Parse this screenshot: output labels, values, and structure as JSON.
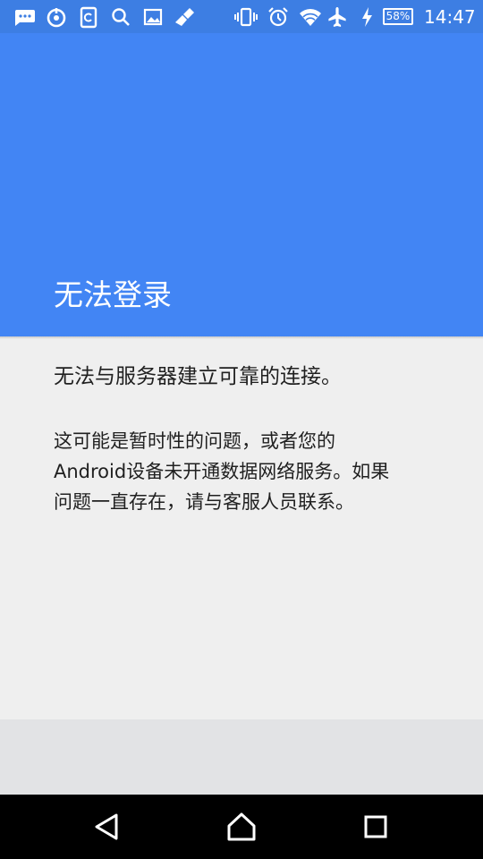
{
  "status_bar": {
    "left_icons": [
      "messages-icon",
      "sync-icon",
      "clipboard-icon",
      "search-icon",
      "image-icon",
      "clean-icon"
    ],
    "right_icons": [
      "vibrate-icon",
      "alarm-icon",
      "wifi-icon",
      "airplane-icon",
      "charging-icon"
    ],
    "battery": "58%",
    "time": "14:47"
  },
  "header": {
    "title": "无法登录",
    "color": "#4285f4"
  },
  "content": {
    "message": "无法与服务器建立可靠的连接。",
    "detail_lines": [
      "这可能是暂时性的问题，或者您的",
      "Android设备未开通数据网络服务。如果",
      "问题一直存在，请与客服人员联系。"
    ]
  },
  "nav_bar": {
    "buttons": [
      "back-icon",
      "home-icon",
      "recents-icon"
    ]
  }
}
